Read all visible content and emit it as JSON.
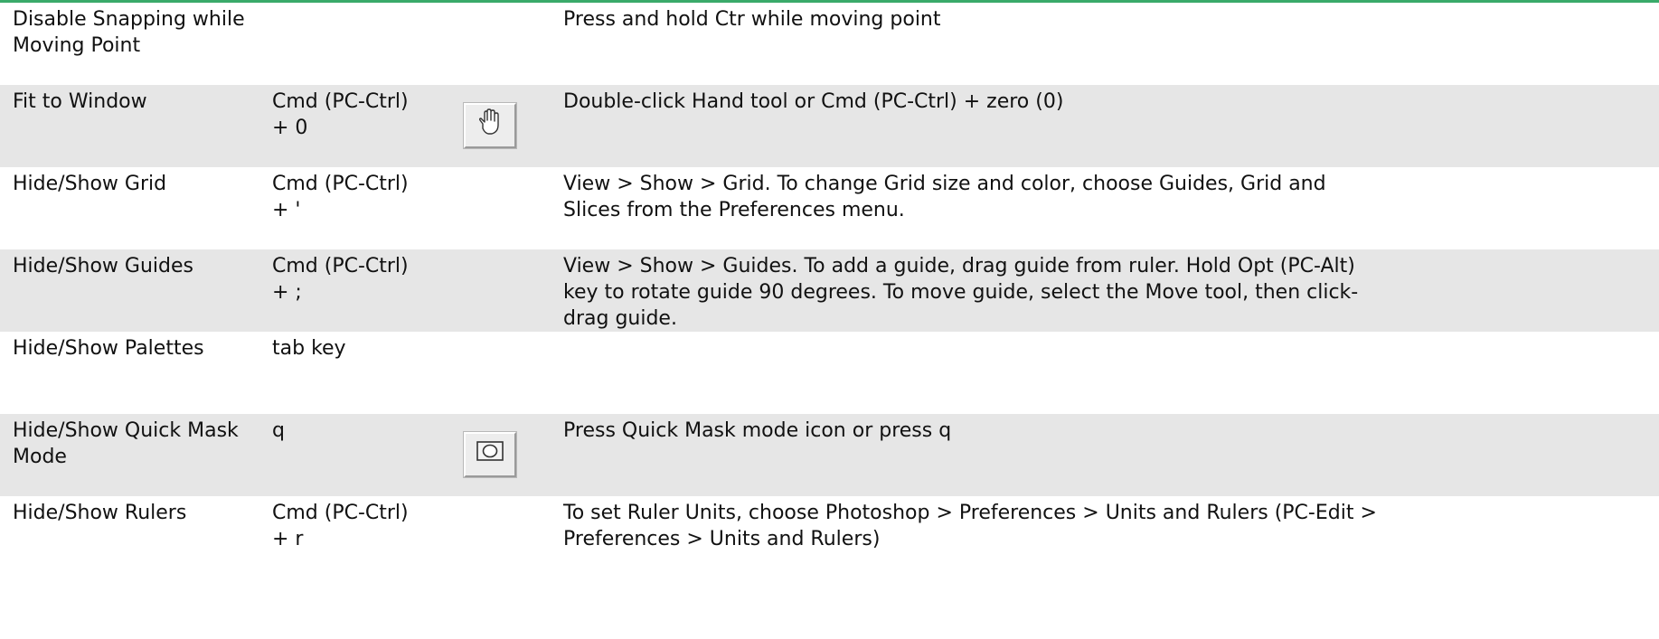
{
  "rows": [
    {
      "name": "Disable Snapping while Moving Point",
      "shortcut": "",
      "icon": "",
      "description": "Press and hold Ctr while moving point"
    },
    {
      "name": "Fit to Window",
      "shortcut": "Cmd (PC-Ctrl) + 0",
      "icon": "hand-tool-icon",
      "description": "Double-click Hand tool or Cmd (PC-Ctrl) + zero (0)"
    },
    {
      "name": "Hide/Show Grid",
      "shortcut": "Cmd (PC-Ctrl) + '",
      "icon": "",
      "description": "View > Show > Grid. To change Grid size and color, choose Guides, Grid and Slices from the Preferences menu."
    },
    {
      "name": "Hide/Show Guides",
      "shortcut": "Cmd (PC-Ctrl) + ;",
      "icon": "",
      "description": "View > Show > Guides. To add a guide, drag guide from ruler. Hold Opt (PC-Alt) key to rotate guide 90 degrees. To move guide, select the Move tool, then click-drag guide."
    },
    {
      "name": "Hide/Show Palettes",
      "shortcut": "tab key",
      "icon": "",
      "description": ""
    },
    {
      "name": "Hide/Show Quick Mask Mode",
      "shortcut": "q",
      "icon": "quick-mask-icon",
      "description": "Press Quick Mask mode icon or press q"
    },
    {
      "name": "Hide/Show Rulers",
      "shortcut": "Cmd (PC-Ctrl) + r",
      "icon": "",
      "description": "To set Ruler Units, choose Photoshop > Preferences > Units and Rulers (PC-Edit > Preferences > Units and Rulers)"
    }
  ]
}
